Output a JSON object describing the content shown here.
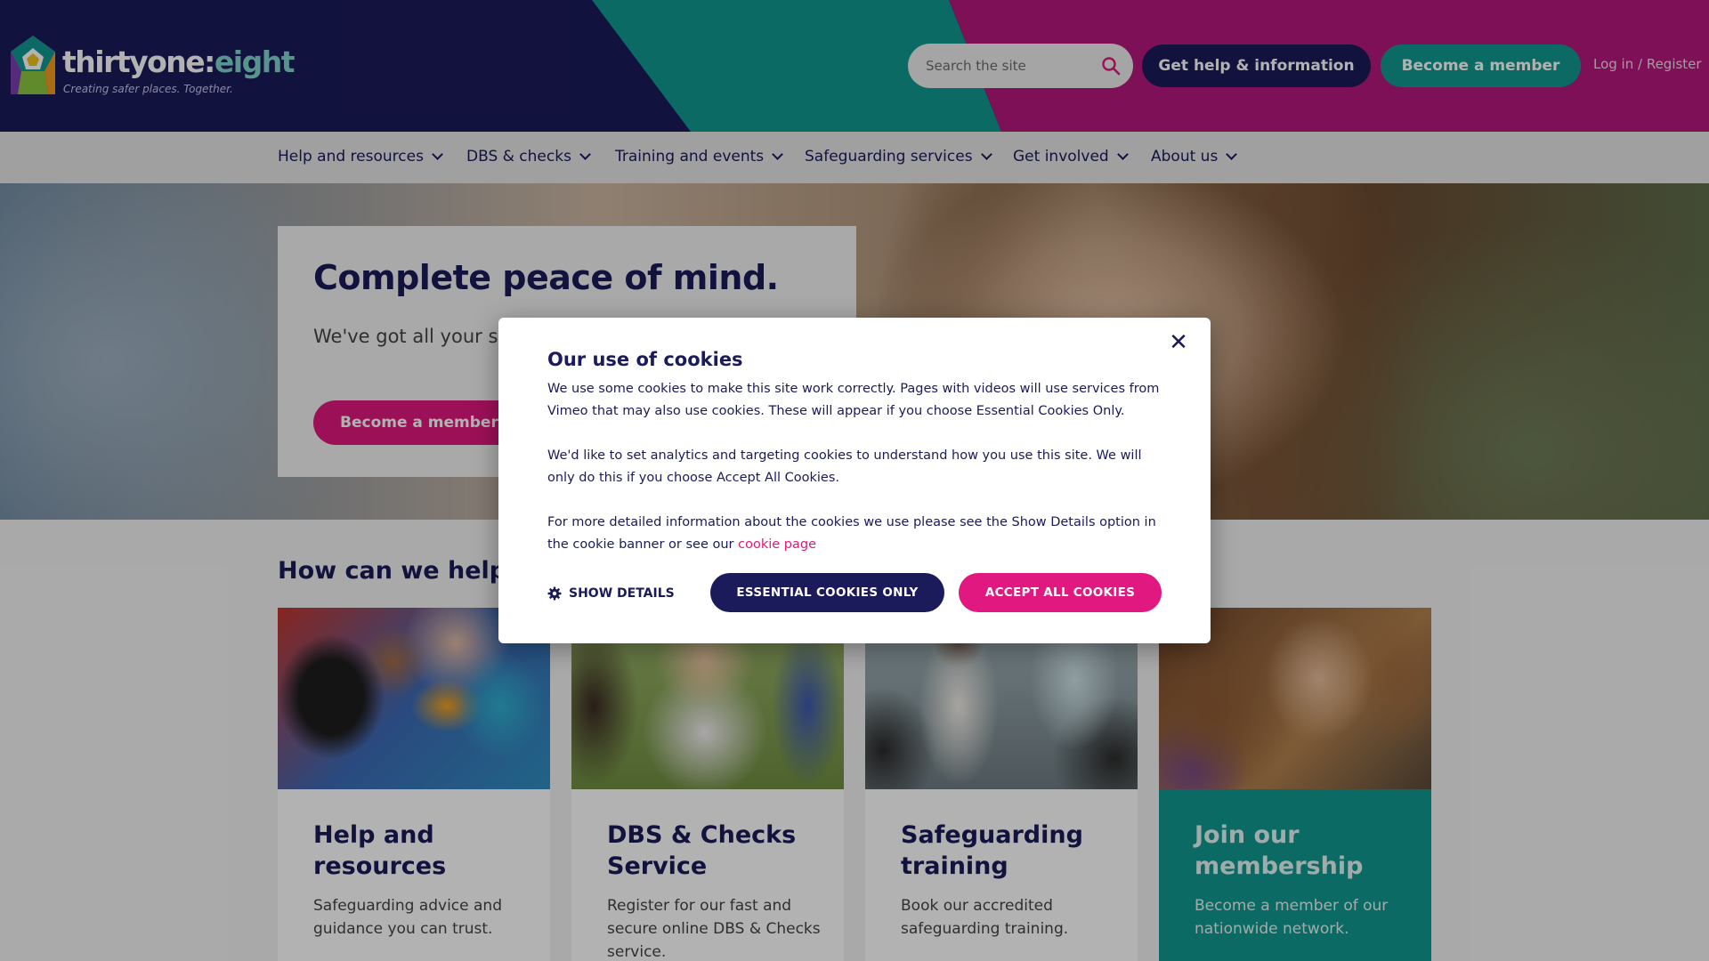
{
  "header": {
    "logo_word": "thirtyone:",
    "logo_accent": "eight",
    "logo_tagline": "Creating safer places. Together.",
    "search_placeholder": "Search the site",
    "help_button": "Get help & information",
    "member_button": "Become a member",
    "login_link": "Log in / Register"
  },
  "nav": {
    "items": [
      {
        "label": "Help and resources"
      },
      {
        "label": "DBS & checks"
      },
      {
        "label": "Training and events"
      },
      {
        "label": "Safeguarding services"
      },
      {
        "label": "Get involved"
      },
      {
        "label": "About us"
      }
    ]
  },
  "hero": {
    "title": "Complete peace of mind.",
    "text": "We've got all your saf checks and training, t",
    "button": "Become a member tod"
  },
  "help": {
    "heading": "How can we help y",
    "cards": [
      {
        "title": "Help and resources",
        "text": "Safeguarding advice and guidance you can trust."
      },
      {
        "title": "DBS & Checks Service",
        "text": "Register for our fast and secure online DBS & Checks service."
      },
      {
        "title": "Safeguarding training",
        "text": "Book our accredited safeguarding training."
      },
      {
        "title": "Join our membership",
        "text": "Become a member of our nationwide network."
      }
    ]
  },
  "cookie_modal": {
    "title": "Our use of cookies",
    "para1": "We use some cookies to make this site work correctly. Pages with videos will use services from Vimeo that may also use cookies. These will appear if you choose Essential Cookies Only.",
    "para2": "We'd like to set analytics and targeting cookies to understand how you use this site. We will only do this if you choose Accept All Cookies.",
    "para3_before": "For more detailed information about the cookies we use please see the Show Details option in the cookie banner or see our ",
    "para3_link": "cookie page",
    "show_details": "SHOW DETAILS",
    "essential_button": "ESSENTIAL COOKIES ONLY",
    "accept_button": "ACCEPT ALL COOKIES",
    "close_symbol": "✕"
  },
  "colors": {
    "navy": "#1b1a5a",
    "teal": "#109a90",
    "pink": "#e0187f",
    "magenta_header": "#b3177b"
  },
  "icons": [
    "logo-mark-icon",
    "search-icon",
    "chevron-down-icon",
    "close-icon",
    "gear-icon"
  ]
}
